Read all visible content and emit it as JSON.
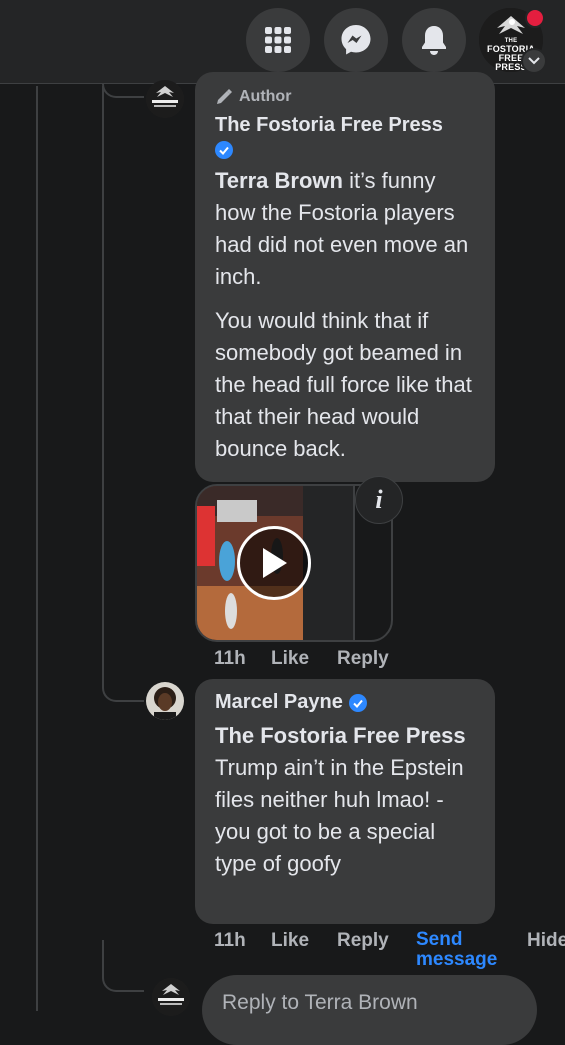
{
  "topbar": {
    "menu_icon": "grid-menu-icon",
    "messenger_icon": "messenger-icon",
    "notifications_icon": "bell-icon",
    "profile_logo_lines": [
      "THE",
      "FOSTORIA",
      "FREE PRESS"
    ],
    "accent": "#e41e3f"
  },
  "comment1": {
    "author_badge": "Author",
    "name": "The Fostoria Free Press",
    "mention": "Terra Brown",
    "text_part1": " it’s funny how the Fostoria players had did not even move an inch.",
    "text_part2": "You would think that if somebody got beamed in the head full force like that that their head would bounce back.",
    "time": "11h",
    "like": "Like",
    "reply": "Reply"
  },
  "comment2": {
    "name": "Marcel Payne",
    "mention": "The Fostoria Free Press",
    "text": " Trump ain’t in the Epstein files neither huh lmao! - you got to be a special type of goofy",
    "time": "11h",
    "like": "Like",
    "reply": "Reply",
    "send_message": "Send message",
    "hide": "Hide"
  },
  "reply_box": {
    "placeholder": "Reply to Terra Brown"
  },
  "colors": {
    "background": "#18191a",
    "bubble": "#3a3b3c",
    "link": "#2d88ff"
  }
}
